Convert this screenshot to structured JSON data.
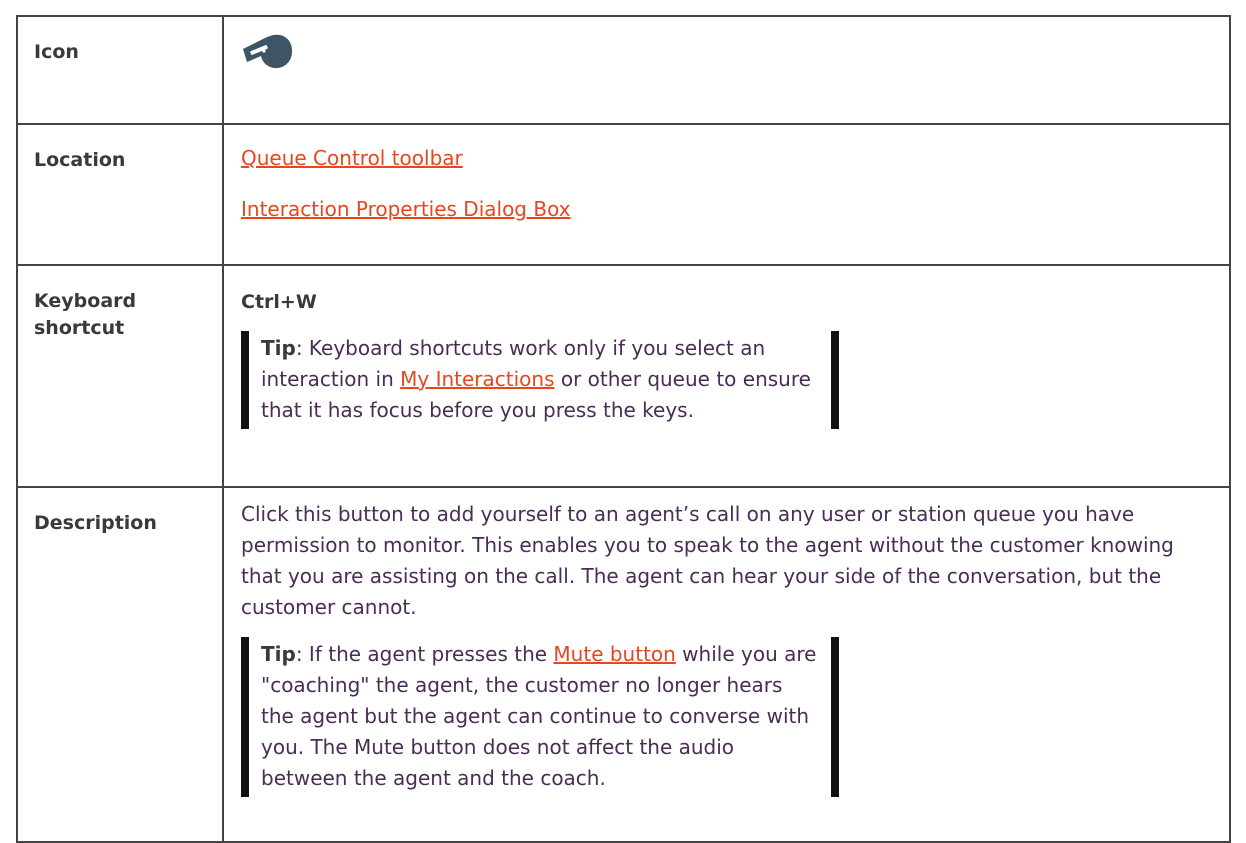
{
  "rows": {
    "icon": {
      "label": "Icon",
      "icon_name": "whistle-icon"
    },
    "location": {
      "label": "Location",
      "links": [
        "Queue Control toolbar",
        "Interaction Properties Dialog Box"
      ]
    },
    "keyboard": {
      "label": "Keyboard shortcut",
      "shortcut": "Ctrl+W",
      "tip": {
        "prefix": "Tip",
        "text1": ": Keyboard shortcuts work only if you select an interaction in ",
        "link": "My Interactions",
        "text2": " or other queue to ensure that it has focus before you press the keys."
      }
    },
    "description": {
      "label": "Description",
      "text": "Click this button to add yourself to an agent’s call on any user or station queue you have permission to monitor. This enables you to speak to the agent without the customer knowing that you are assisting on the call. The agent can hear your side of the conversation, but the customer cannot.",
      "tip": {
        "prefix": "Tip",
        "text1": ": If the agent presses the ",
        "link": "Mute button",
        "text2": " while you are \"coaching\" the agent, the customer no longer hears the agent but the agent can continue to converse with you. The Mute button does not affect the audio between the agent and the coach."
      }
    }
  },
  "colors": {
    "link": "#e8461e",
    "text": "#4a2c55",
    "border": "#444444",
    "icon": "#3e5566"
  }
}
